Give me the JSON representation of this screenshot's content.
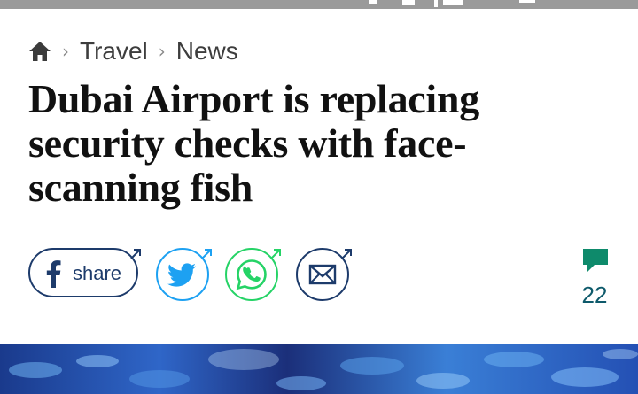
{
  "breadcrumb": {
    "home_icon": "home-icon",
    "items": [
      {
        "label": "Travel"
      },
      {
        "label": "News"
      }
    ],
    "separator": "›"
  },
  "article": {
    "headline": "Dubai Airport is replacing security checks with face-scanning fish"
  },
  "share": {
    "facebook_label": "share",
    "icons": [
      "facebook-icon",
      "twitter-icon",
      "whatsapp-icon",
      "email-icon",
      "external-arrow-icon"
    ],
    "colors": {
      "facebook": "#1d3b6b",
      "twitter": "#1da1f2",
      "whatsapp": "#25d366",
      "email": "#1d3b6b"
    }
  },
  "comments": {
    "icon": "comment-bubble-icon",
    "count": "22",
    "color": "#0e5a6b"
  },
  "hero": {
    "description_icon": "hero-image"
  }
}
